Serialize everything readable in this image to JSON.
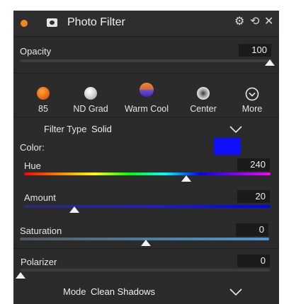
{
  "panel": {
    "title": "Photo Filter",
    "accent_dot_color": "#f0891d",
    "icons": [
      "orange-dot",
      "mask-icon",
      "gear-icon",
      "undo-icon",
      "close-icon"
    ]
  },
  "opacity": {
    "label": "Opacity",
    "value": "100",
    "level": 1.0
  },
  "presets": [
    {
      "label": "85",
      "icon": "orange-sphere"
    },
    {
      "label": "ND Grad",
      "icon": "gray-sphere"
    },
    {
      "label": "Warm Cool",
      "icon": "orange-purple-sphere"
    },
    {
      "label": "Center",
      "icon": "center-sphere"
    },
    {
      "label": "More",
      "icon": "chevron-circle-icon"
    }
  ],
  "filter_type": {
    "label": "Filter Type",
    "value": "Solid"
  },
  "color": {
    "label": "Color:",
    "swatch": "#1010ff"
  },
  "hue": {
    "label": "Hue",
    "value": "240",
    "level": 0.66
  },
  "amount": {
    "label": "Amount",
    "value": "20",
    "level": 0.2
  },
  "saturation": {
    "label": "Saturation",
    "value": "0",
    "level": 0.5
  },
  "polarizer": {
    "label": "Polarizer",
    "value": "0",
    "level": 0.0
  },
  "mode": {
    "label": "Mode",
    "value": "Clean Shadows"
  }
}
